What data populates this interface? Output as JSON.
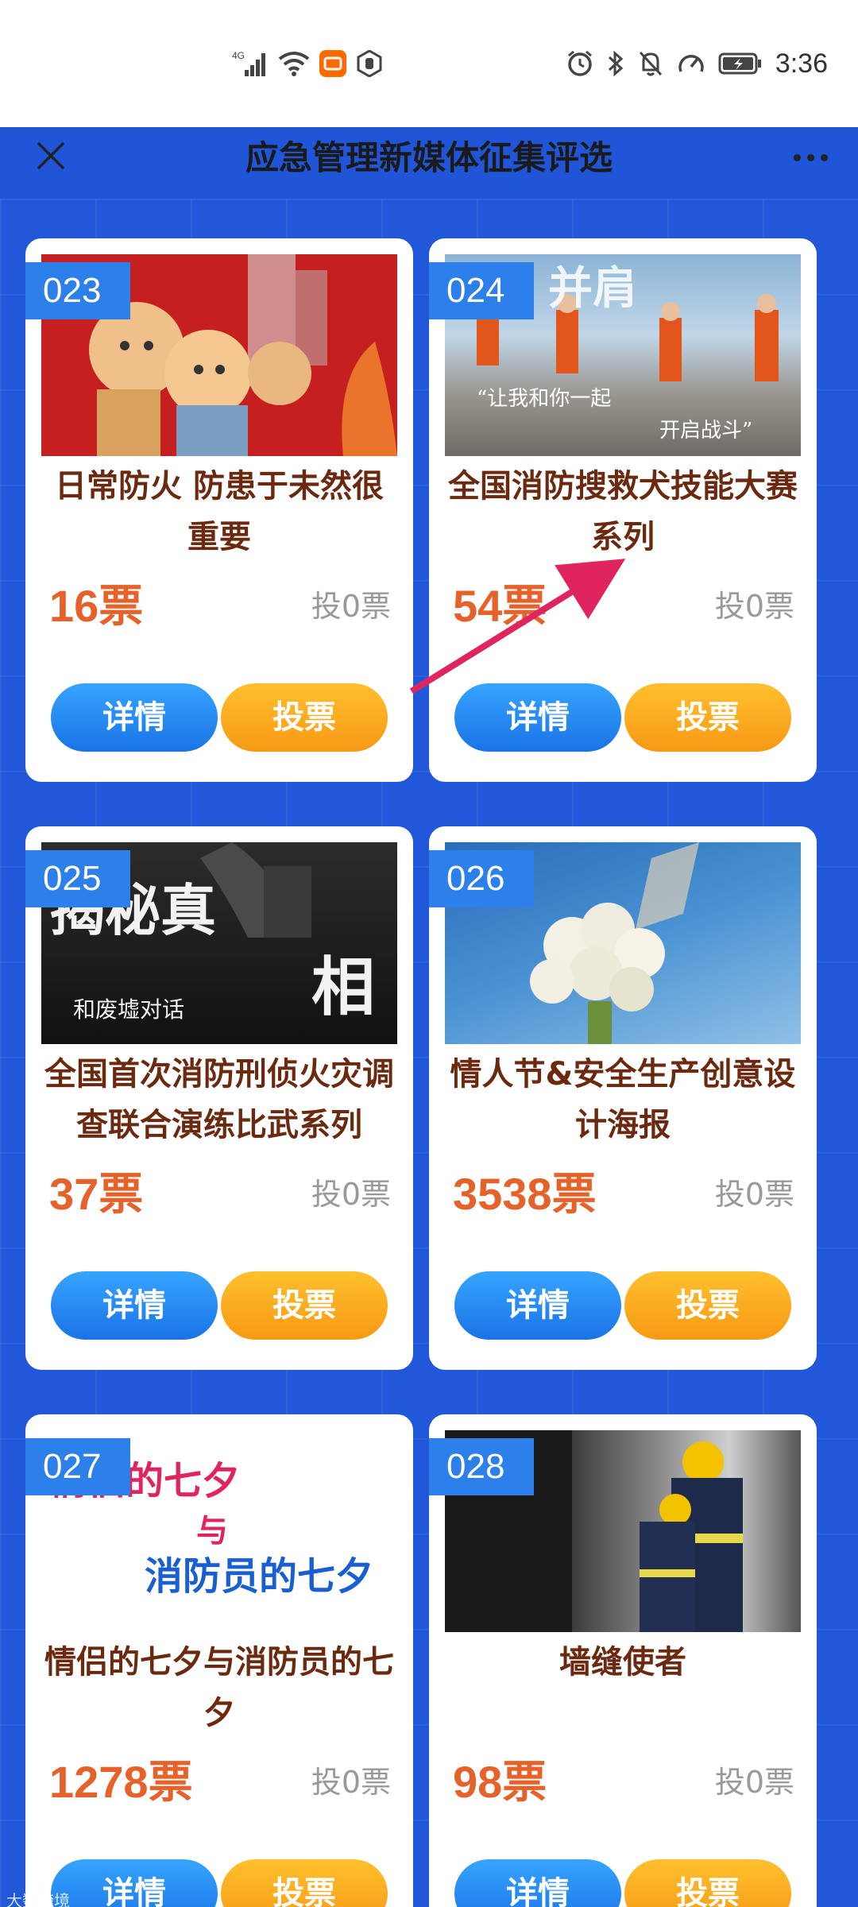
{
  "status_bar": {
    "signal_label": "4G",
    "time": "3:36",
    "icons": [
      "signal-icon",
      "wifi-icon",
      "mi-icon",
      "hand-icon",
      "alarm-icon",
      "bluetooth-icon",
      "mute-icon",
      "speed-icon",
      "battery-icon"
    ]
  },
  "nav": {
    "title": "应急管理新媒体征集评选",
    "close_icon": "close-icon",
    "more_icon": "more-icon"
  },
  "cards": [
    {
      "num": "023",
      "title": "日常防火 防患于未然很重要",
      "votes": "16票",
      "voted": "投0票",
      "detail": "详情",
      "vote": "投票"
    },
    {
      "num": "024",
      "title": "全国消防搜救犬技能大赛系列",
      "votes": "54票",
      "voted": "投0票",
      "detail": "详情",
      "vote": "投票",
      "image_text": [
        "“让我和你一起",
        "开启战斗”",
        "并肩"
      ]
    },
    {
      "num": "025",
      "title": "全国首次消防刑侦火灾调查联合演练比武系列",
      "votes": "37票",
      "voted": "投0票",
      "detail": "详情",
      "vote": "投票",
      "image_text": [
        "揭秘真",
        "相",
        "和废墟对话"
      ]
    },
    {
      "num": "026",
      "title": "情人节&安全生产创意设计海报",
      "votes": "3538票",
      "voted": "投0票",
      "detail": "详情",
      "vote": "投票"
    },
    {
      "num": "027",
      "title": "情侣的七夕与消防员的七夕",
      "votes": "1278票",
      "voted": "投0票",
      "detail": "详情",
      "vote": "投票",
      "image_text": [
        "情侣的七夕",
        "与",
        "消防员的七夕"
      ]
    },
    {
      "num": "028",
      "title": "墙缝使者",
      "votes": "98票",
      "voted": "投0票",
      "detail": "详情",
      "vote": "投票"
    }
  ],
  "watermark": "大数跨境",
  "colors": {
    "page_bg": "#2158d9",
    "badge": "#2d7fea",
    "title_text": "#6b2a0f",
    "votes_text": "#e5622a",
    "detail_button": "#2a8cf5",
    "vote_button": "#f9a51f",
    "arrow": "#e0245e"
  }
}
